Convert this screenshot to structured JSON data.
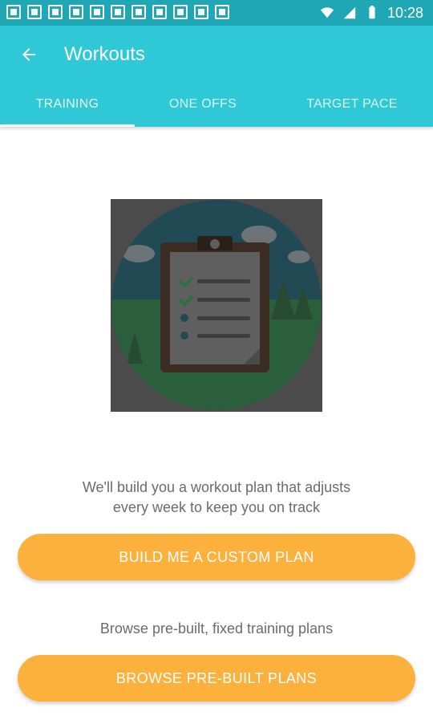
{
  "status_bar": {
    "time": "10:28",
    "notification_icon_count": 11
  },
  "app_bar": {
    "title": "Workouts"
  },
  "tabs": [
    {
      "label": "TRAINING",
      "selected": true
    },
    {
      "label": "ONE OFFS",
      "selected": false
    },
    {
      "label": "TARGET PACE",
      "selected": false
    }
  ],
  "illustration": {
    "icon": "clipboard-checklist"
  },
  "custom_plan": {
    "description_line1": "We'll build you a workout plan that adjusts",
    "description_line2": "every week to keep you on track",
    "button_label": "BUILD ME A CUSTOM PLAN"
  },
  "prebuilt": {
    "description": "Browse pre-built, fixed training plans",
    "button_label": "BROWSE PRE-BUILT PLANS"
  },
  "colors": {
    "status_bar": "#1fa7b6",
    "app_bar": "#2ec8d7",
    "button": "#fbb13c",
    "body_text": "#6b6b6b"
  }
}
